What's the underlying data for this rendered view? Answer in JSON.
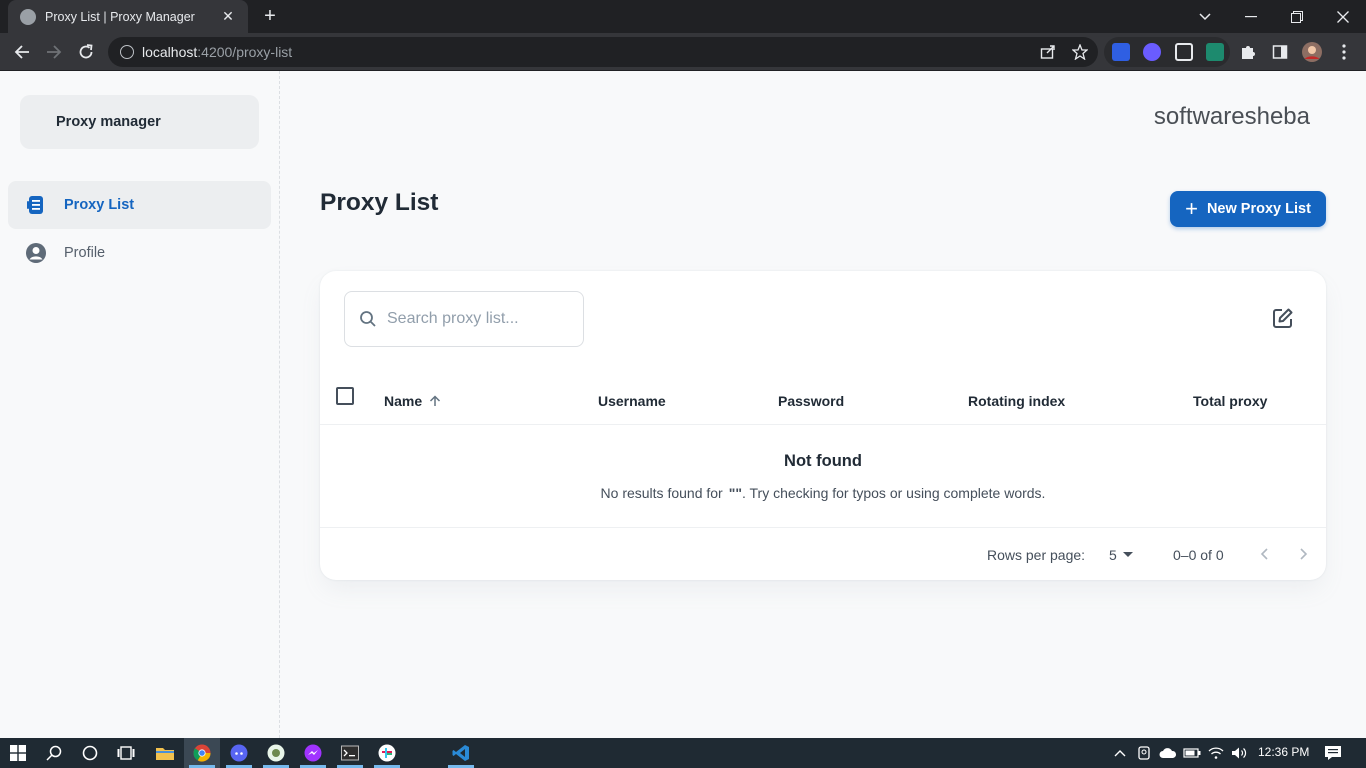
{
  "browser": {
    "tab_title": "Proxy List | Proxy Manager",
    "tab_close": "✕",
    "new_tab": "+",
    "url_host": "localhost",
    "url_path": ":4200/proxy-list"
  },
  "sidebar": {
    "brand": "Proxy manager",
    "items": [
      {
        "label": "Proxy List",
        "icon": "list-icon",
        "active": true
      },
      {
        "label": "Profile",
        "icon": "user-icon",
        "active": false
      }
    ]
  },
  "header": {
    "org_name": "softwaresheba"
  },
  "main": {
    "title": "Proxy List",
    "new_button": "New Proxy List",
    "new_button_icon": "+",
    "search_placeholder": "Search proxy list...",
    "columns": [
      "Name",
      "Username",
      "Password",
      "Rotating index",
      "Total proxy"
    ],
    "sort_column": "Name",
    "sort_direction": "asc",
    "empty_title": "Not found",
    "empty_text_prefix": "No results found for",
    "empty_query": "\"\"",
    "empty_text_suffix": ". Try checking for typos or using complete words.",
    "rows_per_page_label": "Rows per page:",
    "rows_per_page_value": "5",
    "range": "0–0 of 0"
  },
  "taskbar": {
    "time": "12:36 PM"
  },
  "colors": {
    "primary": "#1565c0",
    "sidebar_active_bg": "#eceef0",
    "taskbar": "#1f2a33",
    "browser_dark": "#202124"
  }
}
